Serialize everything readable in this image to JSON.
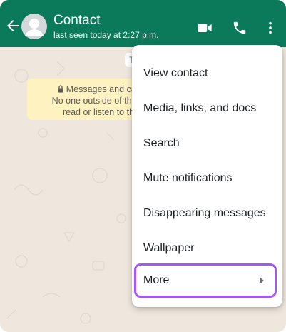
{
  "header": {
    "contact_name": "Contact",
    "status": "last seen today at 2:27 p.m.",
    "icons": [
      "back-arrow-icon",
      "avatar-icon",
      "video-call-icon",
      "voice-call-icon",
      "more-vert-icon"
    ],
    "colors": {
      "bar": "#0b7a5a",
      "text": "#ffffff"
    }
  },
  "chat": {
    "date_chip": "T",
    "encryption_notice": {
      "line1": "Messages and call",
      "line2": "No one outside of this c",
      "line3": "read or listen to th"
    },
    "colors": {
      "background": "#efe7de",
      "notice": "#fff2c1"
    }
  },
  "menu": {
    "items": [
      {
        "label": "View contact"
      },
      {
        "label": "Media, links, and docs"
      },
      {
        "label": "Search"
      },
      {
        "label": "Mute notifications"
      },
      {
        "label": "Disappearing messages"
      },
      {
        "label": "Wallpaper"
      },
      {
        "label": "More"
      }
    ],
    "highlight_color": "#a855f7"
  }
}
